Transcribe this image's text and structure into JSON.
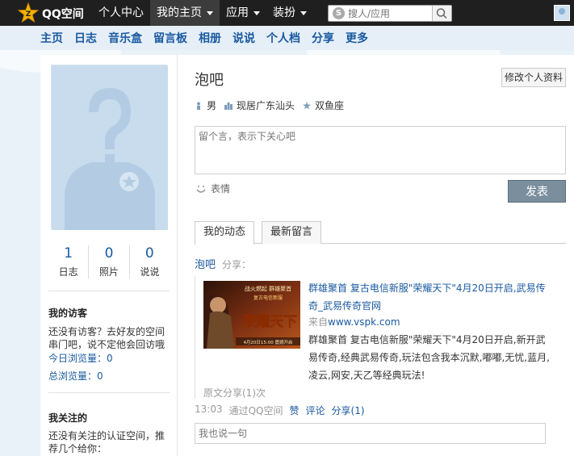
{
  "topbar": {
    "brand": "QQ空间",
    "nav": [
      {
        "label": "个人中心",
        "dropdown": false,
        "active": false
      },
      {
        "label": "我的主页",
        "dropdown": true,
        "active": true
      },
      {
        "label": "应用",
        "dropdown": true,
        "active": false
      },
      {
        "label": "装扮",
        "dropdown": true,
        "active": false
      }
    ],
    "search_placeholder": "搜人/应用"
  },
  "subnav": [
    "主页",
    "日志",
    "音乐盒",
    "留言板",
    "相册",
    "说说",
    "个人档",
    "分享",
    "更多"
  ],
  "profile": {
    "stats": [
      {
        "value": "1",
        "label": "日志"
      },
      {
        "value": "0",
        "label": "照片"
      },
      {
        "value": "0",
        "label": "说说"
      }
    ],
    "visitors_title": "我的访客",
    "visitors_text": "还没有访客？去好友的空间串门吧，说不定他会回访哦",
    "today_views": "今日浏览量：0",
    "total_views": "总浏览量：0",
    "following_title": "我关注的",
    "following_text": "还没有关注的认证空间，推荐几个给你："
  },
  "main": {
    "name": "泡吧",
    "edit_label": "修改个人资料",
    "gender": "男",
    "location": "现居广东汕头",
    "zodiac": "双鱼座",
    "message_placeholder": "留个言，表示下关心吧",
    "emoji_label": "表情",
    "send_label": "发表",
    "tabs": [
      "我的动态",
      "最新留言"
    ],
    "feed": {
      "user": "泡吧",
      "verb": "分享：",
      "title": "群雄聚首 复古电信新服\"荣耀天下\"4月20日开启,武易传奇_武易传奇官网",
      "source_prefix": "来自",
      "source_link": "www.vspk.com",
      "body": "群雄聚首 复古电信新服\"荣耀天下\"4月20日开启,新开武易传奇,经典武易传奇,玩法包含我本沉默,嘟嘟,无忧,蓝月,凌云,网安,天乙等经典玩法!",
      "orig_share": "原文分享(1)次",
      "time": "13:03",
      "via": "通过QQ空间",
      "like": "赞",
      "comment": "评论",
      "share": "分享(1)",
      "reply_placeholder": "我也说一句",
      "thumb_top": "战火燃起 群雄聚首",
      "thumb_sub": "复古电信新服",
      "thumb_main": "荣耀天下",
      "thumb_date": "4月20日15:00 震撼开启"
    }
  },
  "colors": {
    "topbar": "#1f1f1f",
    "link": "#1a5aa0",
    "background": "#e9f2f9",
    "send_button": "#7a8e9e"
  }
}
